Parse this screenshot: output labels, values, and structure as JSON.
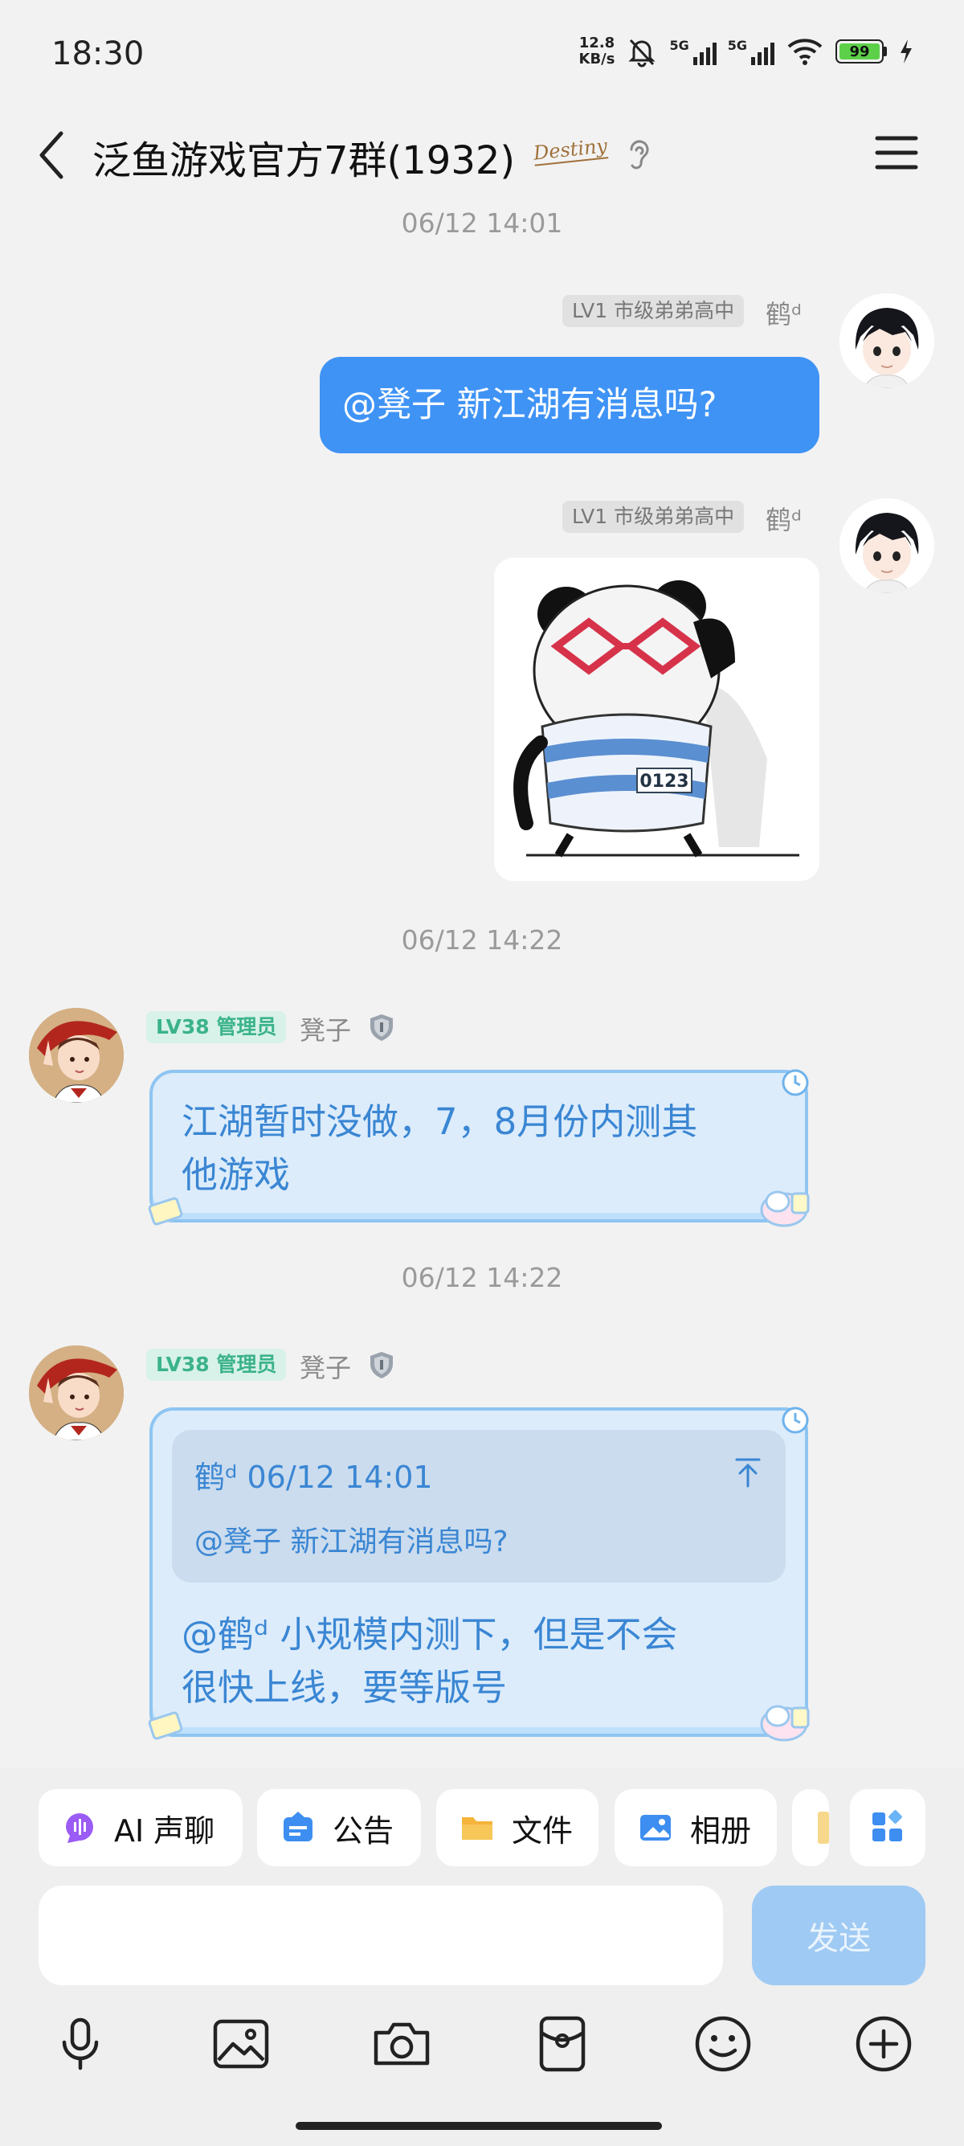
{
  "status_bar": {
    "time": "18:30",
    "net_speed_value": "12.8",
    "net_speed_unit": "KB/s",
    "signal1": "5G",
    "signal2": "5G",
    "battery": "99"
  },
  "header": {
    "title": "泛鱼游戏官方7群(1932)",
    "badge": "Destiny"
  },
  "messages": [
    {
      "timestamp": "06/12 14:01"
    },
    {
      "sender_level": "LV1 市级弟弟高中",
      "sender_name": "鹤ᵈ",
      "text": "@凳子 新江湖有消息吗?"
    },
    {
      "sender_level": "LV1 市级弟弟高中",
      "sender_name": "鹤ᵈ",
      "sticker_label": "0123"
    },
    {
      "timestamp": "06/12 14:22"
    },
    {
      "sender_level": "LV38 管理员",
      "sender_name": "凳子",
      "text": "江湖暂时没做，7，8月份内测其他游戏",
      "text_line1": "江湖暂时没做，7，8月份内测其",
      "text_line2": "他游戏"
    },
    {
      "timestamp": "06/12 14:22"
    },
    {
      "sender_level": "LV38 管理员",
      "sender_name": "凳子",
      "quote_author": "鹤ᵈ",
      "quote_time": "06/12 14:01",
      "quote_text": "@凳子 新江湖有消息吗?",
      "text_line1": "@鹤ᵈ 小规模内测下，但是不会",
      "text_line2": "很快上线，要等版号"
    }
  ],
  "shortcuts": [
    {
      "label": "AI 声聊",
      "icon": "ai-voice-icon",
      "color": "#9b5cf5"
    },
    {
      "label": "公告",
      "icon": "announcement-icon",
      "color": "#3d8ef0"
    },
    {
      "label": "文件",
      "icon": "folder-icon",
      "color": "#f5b43a"
    },
    {
      "label": "相册",
      "icon": "album-icon",
      "color": "#3d8ef0"
    }
  ],
  "composer": {
    "input_value": "",
    "send_label": "发送"
  },
  "toolbar_icons": [
    "mic-icon",
    "image-icon",
    "camera-icon",
    "red-packet-icon",
    "emoji-icon",
    "plus-icon"
  ]
}
